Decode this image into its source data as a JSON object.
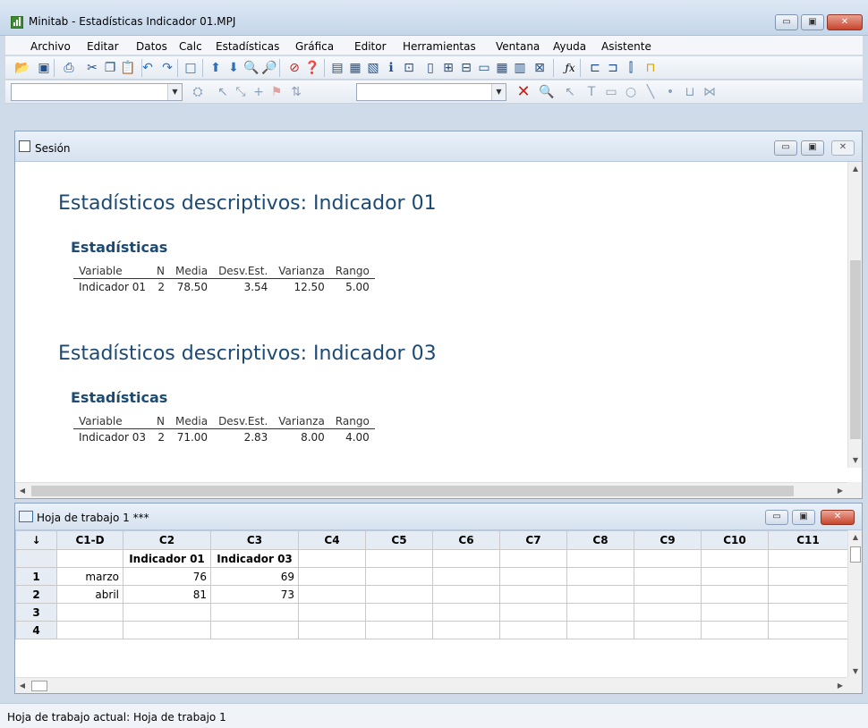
{
  "window": {
    "title": "Minitab - Estadísticas Indicador 01.MPJ",
    "controls": [
      "▭",
      "▣",
      "✕"
    ]
  },
  "menu": [
    "Archivo",
    "Editar",
    "Datos",
    "Calc",
    "Estadísticas",
    "Gráfica",
    "Editor",
    "Herramientas",
    "Ventana",
    "Ayuda",
    "Asistente"
  ],
  "toolbar1": [
    {
      "name": "open-icon",
      "glyph": "📂",
      "color": "#d9a400"
    },
    {
      "name": "save-icon",
      "glyph": "▣",
      "color": "#1f4f8c"
    },
    {
      "name": "print-icon",
      "glyph": "⎙",
      "color": "#1f4f8c"
    },
    {
      "name": "cut-icon",
      "glyph": "✂",
      "color": "#1f4f8c"
    },
    {
      "name": "copy-icon",
      "glyph": "❐",
      "color": "#1f4f8c"
    },
    {
      "name": "paste-icon",
      "glyph": "📋",
      "color": "#1f4f8c"
    },
    {
      "name": "undo-icon",
      "glyph": "↶",
      "color": "#2e6fb7"
    },
    {
      "name": "redo-icon",
      "glyph": "↷",
      "color": "#2e6fb7"
    },
    {
      "name": "window-icon",
      "glyph": "□",
      "color": "#2e6fb7"
    },
    {
      "name": "arrow-up-icon",
      "glyph": "⬆",
      "color": "#2e6fb7"
    },
    {
      "name": "arrow-down-icon",
      "glyph": "⬇",
      "color": "#2e6fb7"
    },
    {
      "name": "find-icon",
      "glyph": "🔍",
      "color": "#333"
    },
    {
      "name": "find-next-icon",
      "glyph": "🔎",
      "color": "#333"
    },
    {
      "name": "cancel-icon",
      "glyph": "⊘",
      "color": "#c8201a"
    },
    {
      "name": "help-icon",
      "glyph": "❓",
      "color": "#1f4f8c"
    },
    {
      "name": "session-icon",
      "glyph": "▤",
      "color": "#1f4f8c"
    },
    {
      "name": "worksheet-icon",
      "glyph": "▦",
      "color": "#1f4f8c"
    },
    {
      "name": "graph-icon",
      "glyph": "▧",
      "color": "#1f4f8c"
    },
    {
      "name": "info-icon",
      "glyph": "ℹ",
      "color": "#1f4f8c"
    },
    {
      "name": "history-icon",
      "glyph": "⊡",
      "color": "#1f4f8c"
    },
    {
      "name": "report-icon",
      "glyph": "▯",
      "color": "#1f4f8c"
    },
    {
      "name": "new-worksheet-icon",
      "glyph": "⊞",
      "color": "#1f4f8c"
    },
    {
      "name": "tile-icon",
      "glyph": "⊟",
      "color": "#1f4f8c"
    },
    {
      "name": "sheet-icon",
      "glyph": "▭",
      "color": "#1f4f8c"
    },
    {
      "name": "table-icon",
      "glyph": "▦",
      "color": "#1f4f8c"
    },
    {
      "name": "layout-icon",
      "glyph": "▥",
      "color": "#1f4f8c"
    },
    {
      "name": "close-graphs-icon",
      "glyph": "⊠",
      "color": "#1f4f8c"
    },
    {
      "name": "function-icon",
      "glyph": "ƒx",
      "color": "#000"
    },
    {
      "name": "insert-cells-icon",
      "glyph": "⊏",
      "color": "#1f4f8c"
    },
    {
      "name": "insert-rows-icon",
      "glyph": "⊐",
      "color": "#1f4f8c"
    },
    {
      "name": "insert-cols-icon",
      "glyph": "⫿",
      "color": "#1f4f8c"
    },
    {
      "name": "move-cols-icon",
      "glyph": "⊓",
      "color": "#d9a400"
    }
  ],
  "toolbar2": [
    {
      "name": "brush-icon",
      "glyph": "⛭",
      "color": "#8aa0b8"
    },
    {
      "name": "pointer-icon",
      "glyph": "↖",
      "color": "#8aa0b8"
    },
    {
      "name": "crosshair-icon",
      "glyph": "⤡",
      "color": "#8aa0b8"
    },
    {
      "name": "plus-icon",
      "glyph": "+",
      "color": "#8aa0b8"
    },
    {
      "name": "flag-icon",
      "glyph": "⚑",
      "color": "#d9a4a4"
    },
    {
      "name": "swap-icon",
      "glyph": "⇅",
      "color": "#8aa0b8"
    },
    {
      "name": "delete-icon",
      "glyph": "✕",
      "color": "#c8201a"
    },
    {
      "name": "zoom-icon",
      "glyph": "🔍",
      "color": "#8aa0b8"
    },
    {
      "name": "select-icon",
      "glyph": "↖",
      "color": "#8aa0b8"
    },
    {
      "name": "text-tool-icon",
      "glyph": "T",
      "color": "#8aa0b8"
    },
    {
      "name": "rectangle-tool-icon",
      "glyph": "▭",
      "color": "#8aa0b8"
    },
    {
      "name": "ellipse-tool-icon",
      "glyph": "○",
      "color": "#8aa0b8"
    },
    {
      "name": "line-tool-icon",
      "glyph": "╲",
      "color": "#8aa0b8"
    },
    {
      "name": "dot-tool-icon",
      "glyph": "•",
      "color": "#8aa0b8"
    },
    {
      "name": "polyline-tool-icon",
      "glyph": "⊔",
      "color": "#8aa0b8"
    },
    {
      "name": "polygon-tool-icon",
      "glyph": "⋈",
      "color": "#8aa0b8"
    }
  ],
  "session": {
    "title": "Sesión",
    "blocks": [
      {
        "heading": "Estadísticos descriptivos: Indicador 01",
        "subheading": "Estadísticas",
        "columns": [
          "Variable",
          "N",
          "Media",
          "Desv.Est.",
          "Varianza",
          "Rango"
        ],
        "row": [
          "Indicador 01",
          "2",
          "78.50",
          "3.54",
          "12.50",
          "5.00"
        ]
      },
      {
        "heading": "Estadísticos descriptivos: Indicador 03",
        "subheading": "Estadísticas",
        "columns": [
          "Variable",
          "N",
          "Media",
          "Desv.Est.",
          "Varianza",
          "Rango"
        ],
        "row": [
          "Indicador 03",
          "2",
          "71.00",
          "2.83",
          "8.00",
          "4.00"
        ]
      }
    ]
  },
  "worksheet": {
    "title": "Hoja de trabajo 1 ***",
    "corner": "↓",
    "columns": [
      "C1-D",
      "C2",
      "C3",
      "C4",
      "C5",
      "C6",
      "C7",
      "C8",
      "C9",
      "C10",
      "C11"
    ],
    "names": [
      "",
      "Indicador 01",
      "Indicador 03",
      "",
      "",
      "",
      "",
      "",
      "",
      "",
      ""
    ],
    "rows": [
      {
        "n": "1",
        "cells": [
          "marzo",
          "76",
          "69",
          "",
          "",
          "",
          "",
          "",
          "",
          "",
          ""
        ]
      },
      {
        "n": "2",
        "cells": [
          "abril",
          "81",
          "73",
          "",
          "",
          "",
          "",
          "",
          "",
          "",
          ""
        ]
      },
      {
        "n": "3",
        "cells": [
          "",
          "",
          "",
          "",
          "",
          "",
          "",
          "",
          "",
          "",
          ""
        ]
      },
      {
        "n": "4",
        "cells": [
          "",
          "",
          "",
          "",
          "",
          "",
          "",
          "",
          "",
          "",
          ""
        ]
      }
    ]
  },
  "status": "Hoja de trabajo actual: Hoja de trabajo 1"
}
